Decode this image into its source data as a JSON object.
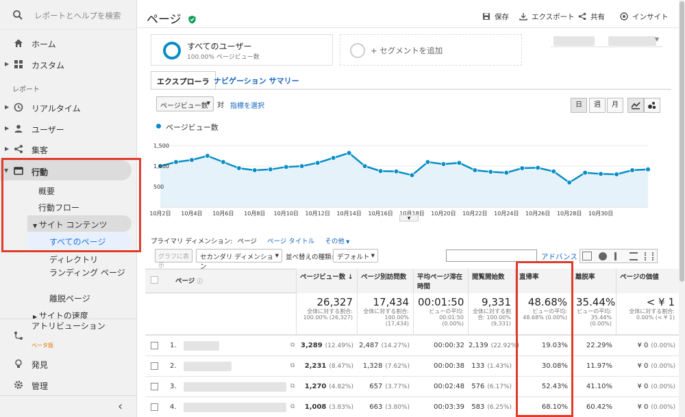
{
  "sidebar": {
    "search_placeholder": "レポートとヘルプを検索",
    "home": "ホーム",
    "custom": "カスタム",
    "reports_label": "レポート",
    "realtime": "リアルタイム",
    "users": "ユーザー",
    "acquisition": "集客",
    "behavior": "行動",
    "overview": "概要",
    "behavior_flow": "行動フロー",
    "site_content": "サイト コンテンツ",
    "all_pages": "すべてのページ",
    "directory": "ディレクトリ",
    "landing_pages": "ランディング ページ",
    "exit_pages": "離脱ページ",
    "site_speed": "サイトの速度",
    "attribution": "アトリビューション",
    "beta": "ベータ版",
    "discover": "発見",
    "admin": "管理",
    "collapse": "‹"
  },
  "header": {
    "title": "ページ",
    "save": "保存",
    "export": "エクスポート",
    "share": "共有",
    "insight": "インサイト"
  },
  "segments": {
    "all_users": "すべてのユーザー",
    "all_users_sub": "100.00% ページビュー数",
    "add_segment": "+ セグメントを追加"
  },
  "tabs": [
    "エクスプローラ",
    "ナビゲーション サマリー"
  ],
  "chart_controls": {
    "metric": "ページビュー数",
    "vs": "対",
    "select_metric": "指標を選択",
    "day": "日",
    "week": "週",
    "month": "月"
  },
  "chart_data": {
    "type": "line",
    "series": [
      {
        "name": "ページビュー数",
        "values": [
          1000,
          1100,
          1150,
          1250,
          1100,
          950,
          900,
          920,
          980,
          1000,
          1080,
          1200,
          1320,
          1000,
          880,
          870,
          780,
          1100,
          1050,
          1080,
          900,
          860,
          840,
          950,
          960,
          870,
          600,
          840,
          810,
          800,
          900,
          920
        ]
      },
      {
        "name": "",
        "values": []
      }
    ],
    "x_ticks": [
      "10月2日",
      "10月4日",
      "10月6日",
      "10月8日",
      "10月10日",
      "10月12日",
      "10月14日",
      "10月16日",
      "10月18日",
      "10月20日",
      "10月22日",
      "10月24日",
      "10月26日",
      "10月28日",
      "10月30日"
    ],
    "y_ticks": [
      "1,500",
      "1,000",
      "500"
    ],
    "ylim": [
      0,
      1600
    ],
    "grid": true,
    "color": "#058dc7"
  },
  "dimension_bar": {
    "primary_label": "プライマリ ディメンション:",
    "page": "ページ",
    "page_title": "ページ タイトル",
    "other": "その他",
    "plot_rows": "グラフに表示",
    "secondary": "セカンダリ ディメンション",
    "sort_label": "並べ替えの種類:",
    "sort_value": "デフォルト",
    "advanced": "アドバンス"
  },
  "table": {
    "headers": [
      "ページ",
      "ページビュー数",
      "ページ別訪問数",
      "平均ページ滞在時間",
      "閲覧開始数",
      "直帰率",
      "離脱率",
      "ページの価値"
    ],
    "totals": [
      {
        "big": "26,327",
        "sm": "全体に対する割合: 100.00% (26,327)"
      },
      {
        "big": "17,434",
        "sm": "全体に対する割合: 100.00% (17,434)"
      },
      {
        "big": "00:01:50",
        "sm": "ビューの平均: 00:01:50 (0.00%)"
      },
      {
        "big": "9,331",
        "sm": "全体に対する割合: 100.00% (9,331)"
      },
      {
        "big": "48.68%",
        "sm": "ビューの平均: 48.68% (0.00%)"
      },
      {
        "big": "35.44%",
        "sm": "ビューの平均: 35.44% (0.00%)"
      },
      {
        "big": "< ¥ 1",
        "sm": "全体に対する割合: 0.00% (< ¥ 1)"
      }
    ],
    "rows": [
      {
        "n": "1.",
        "pv": "3,289",
        "pv_pct": "(12.49%)",
        "upv": "2,487",
        "upv_pct": "(14.27%)",
        "time": "00:00:32",
        "ent": "2,139",
        "ent_pct": "(22.92%)",
        "bounce": "19.03%",
        "exit": "22.29%",
        "val": "¥ 0",
        "val_pct": "(0.00%)"
      },
      {
        "n": "2.",
        "pv": "2,231",
        "pv_pct": "(8.47%)",
        "upv": "1,328",
        "upv_pct": "(7.62%)",
        "time": "00:00:38",
        "ent": "133",
        "ent_pct": "(1.43%)",
        "bounce": "30.08%",
        "exit": "11.97%",
        "val": "¥ 0",
        "val_pct": "(0.00%)"
      },
      {
        "n": "3.",
        "pv": "1,270",
        "pv_pct": "(4.82%)",
        "upv": "657",
        "upv_pct": "(3.77%)",
        "time": "00:02:48",
        "ent": "576",
        "ent_pct": "(6.17%)",
        "bounce": "52.43%",
        "exit": "41.10%",
        "val": "¥ 0",
        "val_pct": "(0.00%)"
      },
      {
        "n": "4.",
        "pv": "1,008",
        "pv_pct": "(3.83%)",
        "upv": "663",
        "upv_pct": "(3.80%)",
        "time": "00:03:39",
        "ent": "583",
        "ent_pct": "(6.25%)",
        "bounce": "68.10%",
        "exit": "60.42%",
        "val": "¥ 0",
        "val_pct": "(0.00%)"
      }
    ]
  }
}
